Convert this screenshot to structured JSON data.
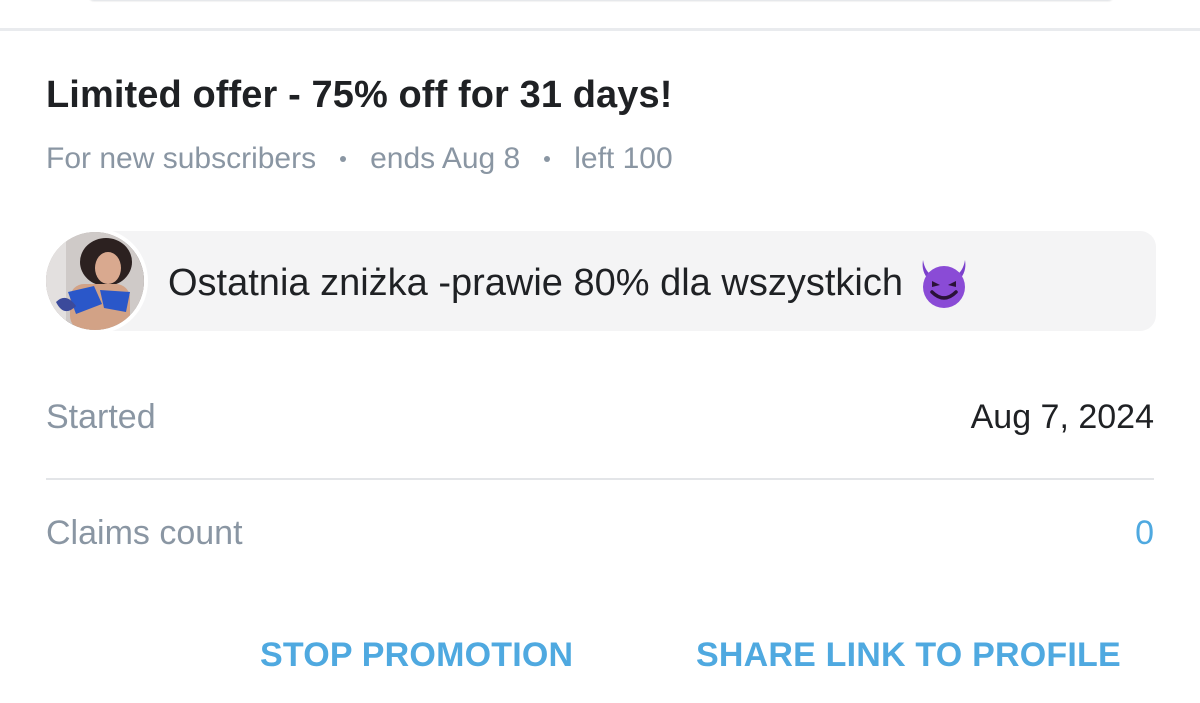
{
  "offer": {
    "title": "Limited offer - 75% off for 31 days!",
    "audience": "For new subscribers",
    "ends": "ends Aug 8",
    "left": "left 100"
  },
  "message": {
    "text": "Ostatnia zniżka -prawie 80% dla wszystkich",
    "emoji_icon": "smiling-devil-emoji-icon"
  },
  "details": {
    "started_label": "Started",
    "started_value": "Aug 7, 2024",
    "claims_label": "Claims count",
    "claims_value": "0"
  },
  "actions": {
    "stop_label": "STOP PROMOTION",
    "share_label": "SHARE LINK TO PROFILE"
  },
  "colors": {
    "accent": "#4fa9e0",
    "muted_text": "#8a96a3",
    "primary_text": "#1f2124",
    "bubble_bg": "#f4f4f5",
    "devil_purple": "#8a4bd6"
  }
}
